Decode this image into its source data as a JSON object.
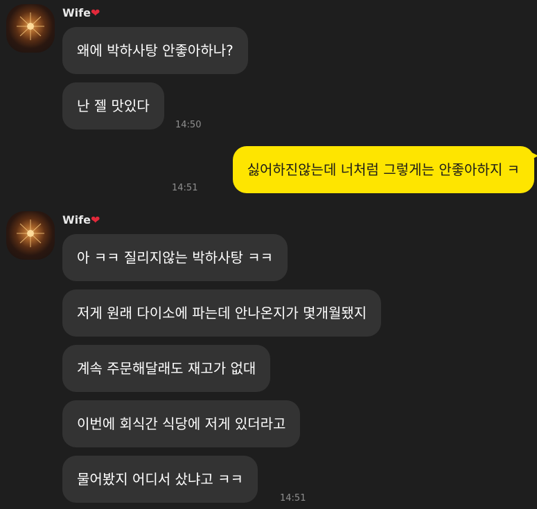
{
  "colors": {
    "background": "#1e1e1e",
    "incoming_bubble": "#333333",
    "outgoing_bubble": "#fee500",
    "timestamp": "#8f8f8f",
    "heart": "#e2293a"
  },
  "groups": [
    {
      "sender": "Wife",
      "sender_badge": "❤",
      "avatar": "fireworks-avatar",
      "messages": [
        "왜에 박하사탕 안좋아하나?",
        "난 젤 맛있다"
      ],
      "time": "14:50"
    },
    {
      "outgoing": true,
      "messages": [
        "싫어하진않는데 너처럼 그렇게는 안좋아하지 ㅋ"
      ],
      "time": "14:51"
    },
    {
      "sender": "Wife",
      "sender_badge": "❤",
      "avatar": "fireworks-avatar",
      "messages": [
        "아 ㅋㅋ 질리지않는 박하사탕 ㅋㅋ",
        "저게 원래 다이소에 파는데 안나온지가 몇개월됐지",
        "계속 주문해달래도 재고가 없대",
        "이번에 회식간 식당에 저게 있더라고",
        "물어봤지 어디서 샀냐고 ㅋㅋ"
      ],
      "time": "14:51"
    }
  ]
}
